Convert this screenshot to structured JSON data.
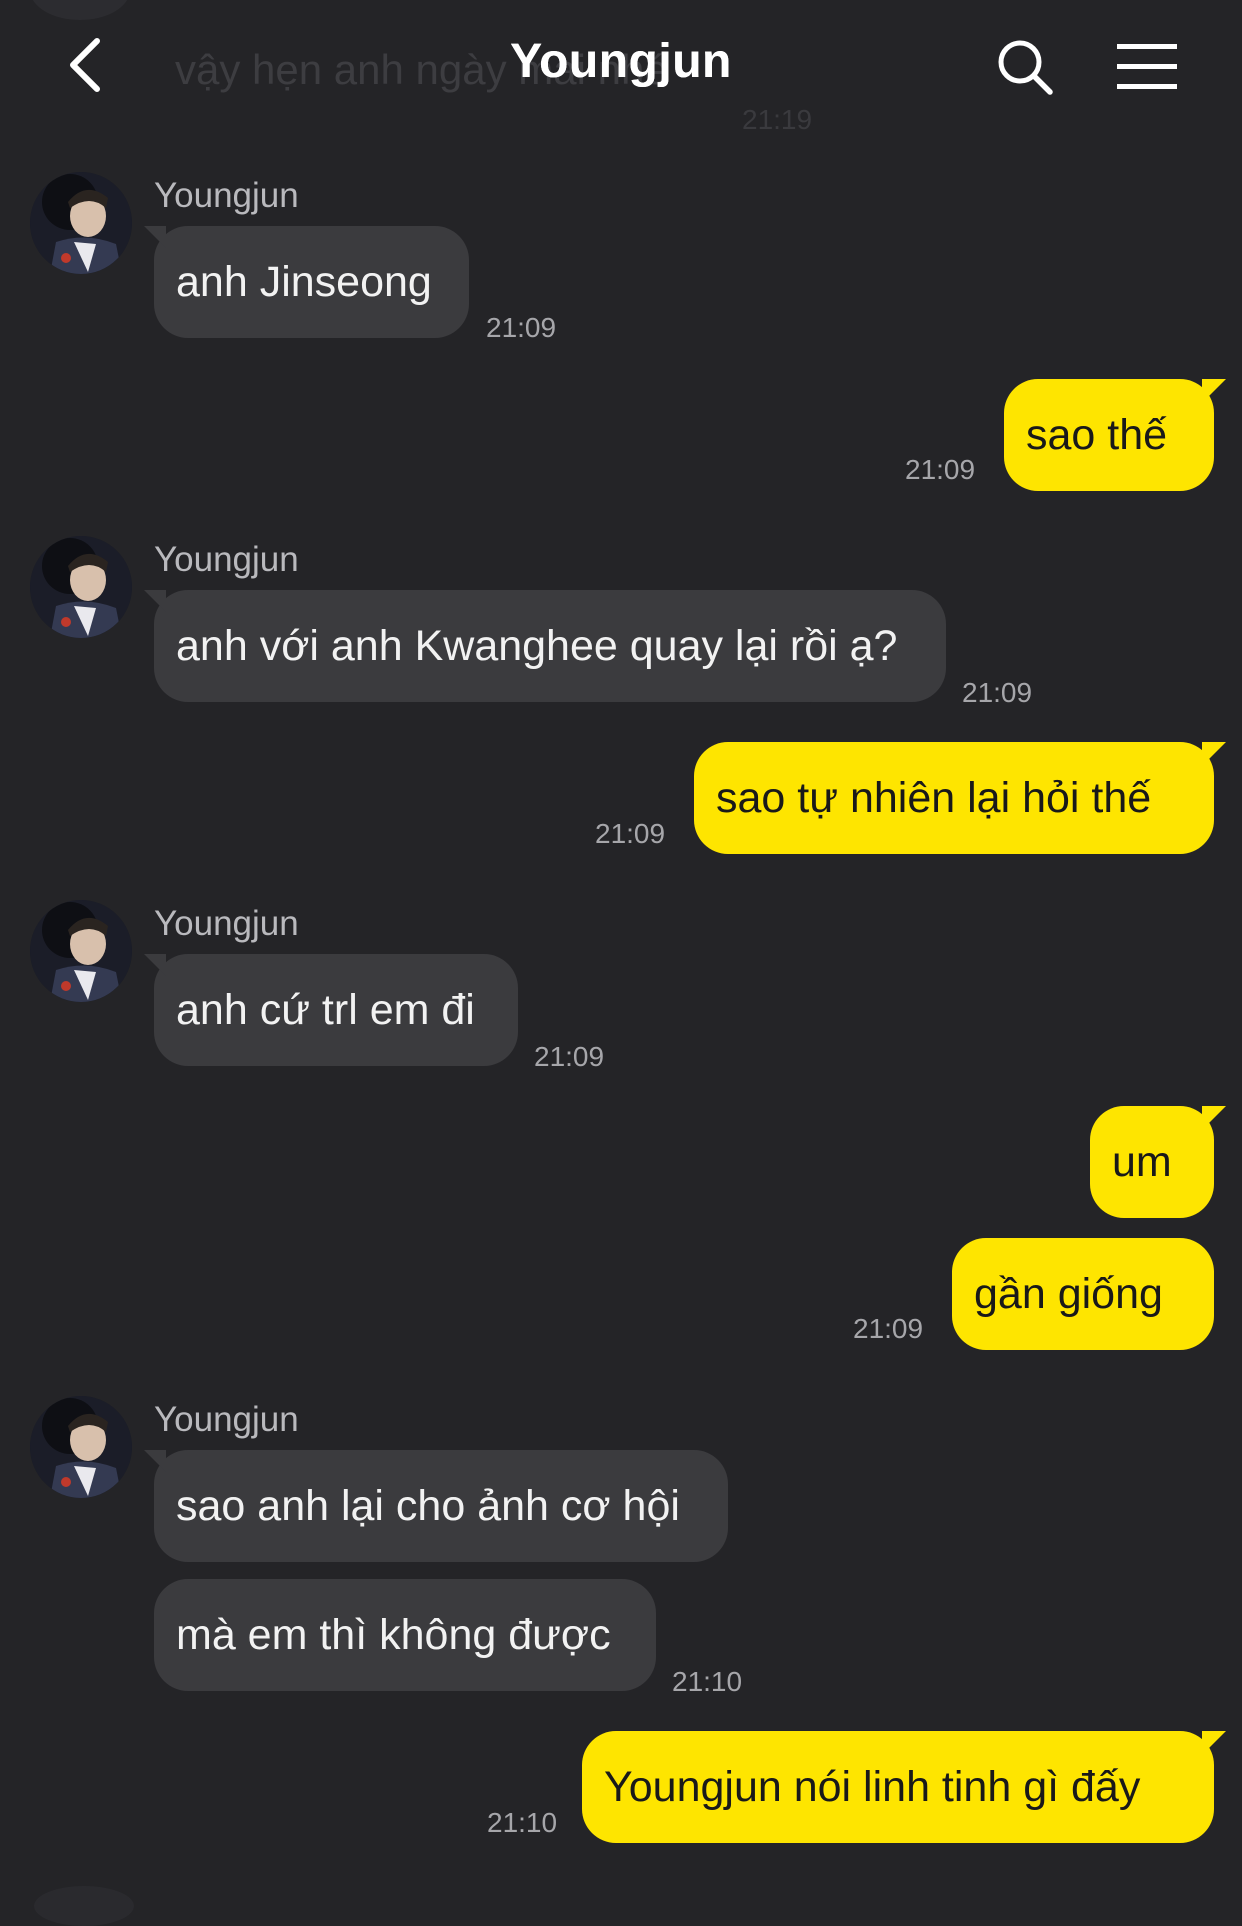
{
  "header": {
    "title": "Youngjun",
    "ghost_message": "vậy hẹn anh ngày mai nhé",
    "ghost_time": "21:19"
  },
  "contact": {
    "name": "Youngjun"
  },
  "messages": {
    "m1": {
      "text": "anh Jinseong",
      "time": "21:09"
    },
    "m2": {
      "text": "sao thế",
      "time": "21:09"
    },
    "m3": {
      "text": "anh với anh Kwanghee quay lại rồi ạ?",
      "time": "21:09"
    },
    "m4": {
      "text": "sao tự nhiên lại hỏi thế",
      "time": "21:09"
    },
    "m5": {
      "text": "anh cứ trl em đi",
      "time": "21:09"
    },
    "m6": {
      "text": "um"
    },
    "m7": {
      "text": "gần giống",
      "time": "21:09"
    },
    "m8": {
      "text": "sao anh lại cho ảnh cơ hội"
    },
    "m9": {
      "text": "mà em thì không được",
      "time": "21:10"
    },
    "m10": {
      "text": "Youngjun nói linh tinh gì đấy",
      "time": "21:10"
    }
  },
  "colors": {
    "background": "#242427",
    "incoming_bubble": "#3b3b3e",
    "outgoing_bubble": "#fee500"
  },
  "icons": [
    "back-arrow-icon",
    "search-icon",
    "menu-icon",
    "avatar"
  ]
}
